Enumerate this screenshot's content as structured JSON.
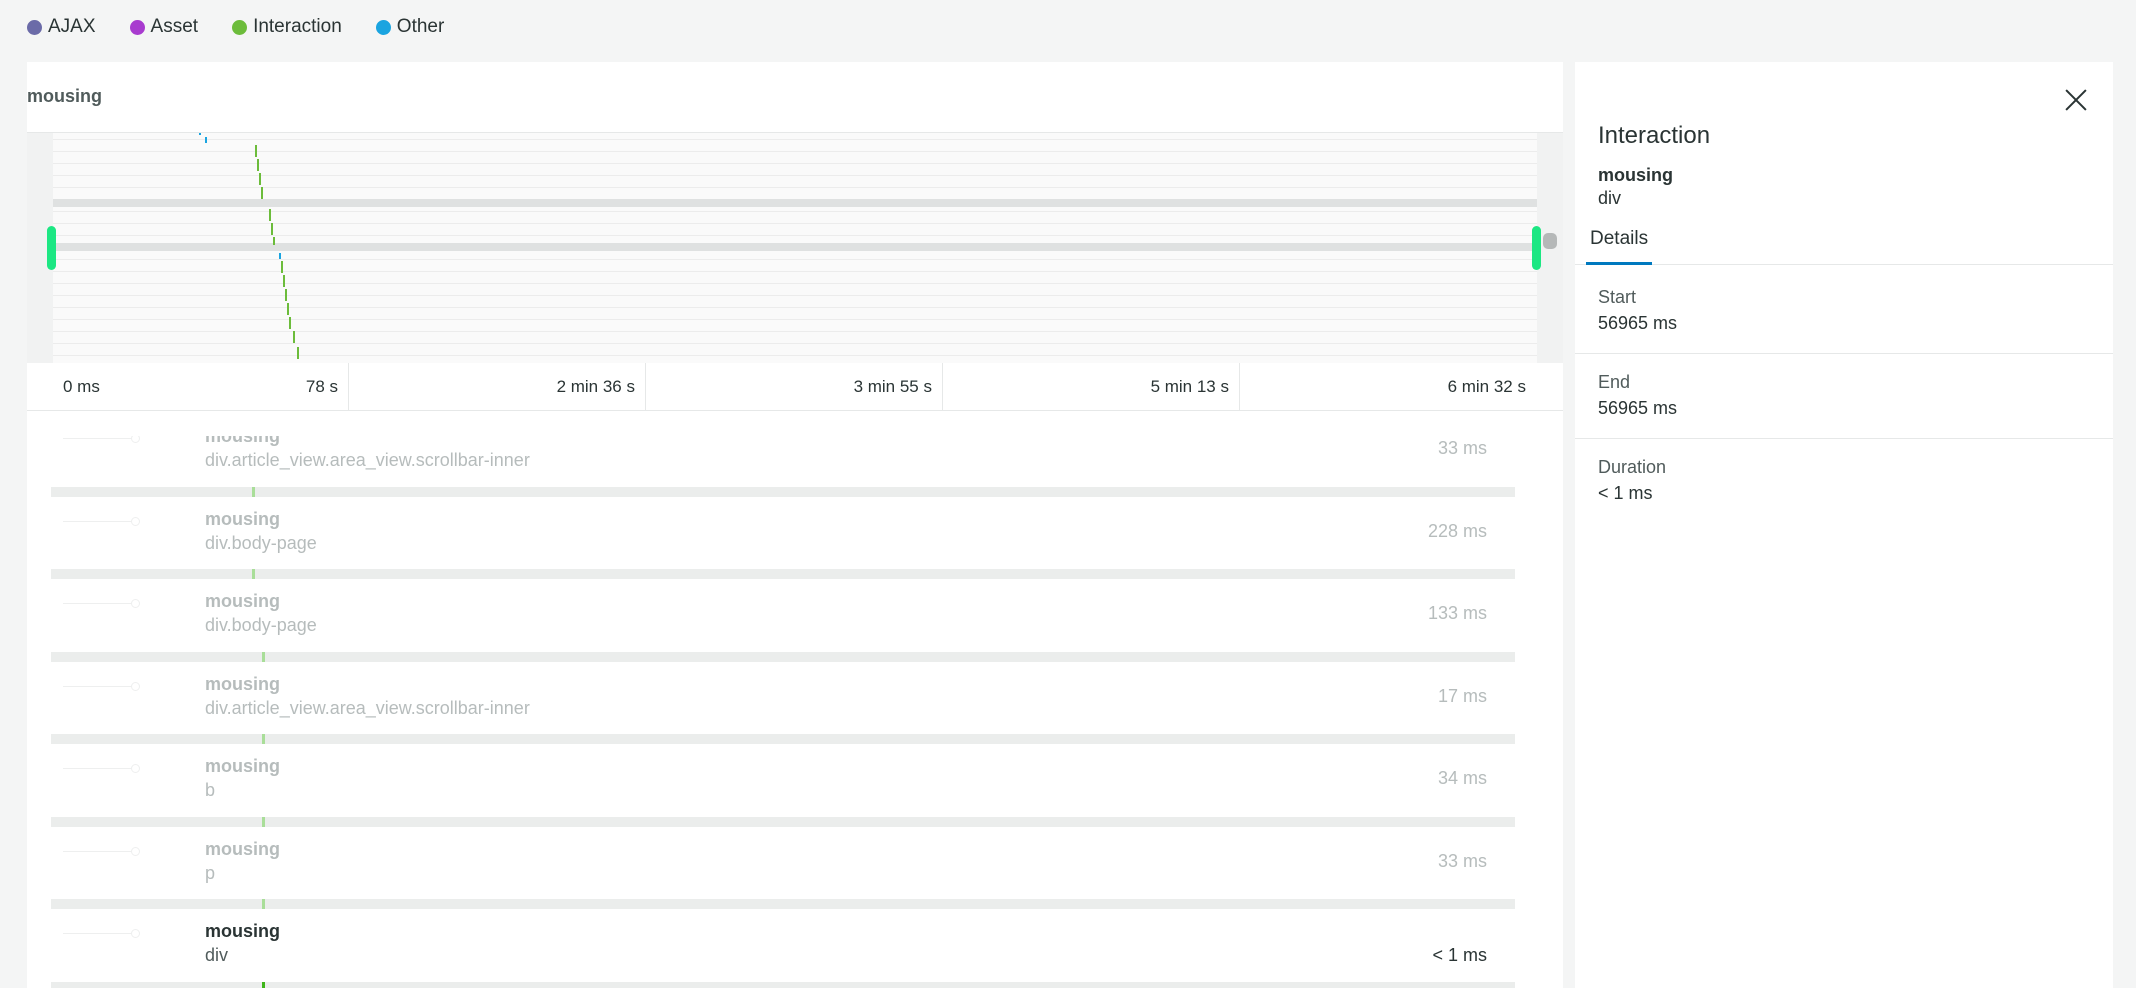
{
  "legend": [
    {
      "label": "AJAX",
      "color": "#6b6ba8"
    },
    {
      "label": "Asset",
      "color": "#a83bcf"
    },
    {
      "label": "Interaction",
      "color": "#6cbc3b"
    },
    {
      "label": "Other",
      "color": "#1aa4e0"
    }
  ],
  "panel": {
    "title": "mousing"
  },
  "axis": {
    "ticks": [
      "0 ms",
      "78 s",
      "2 min 36 s",
      "3 min 55 s",
      "5 min 13 s",
      "6 min 32 s"
    ]
  },
  "rows": [
    {
      "name": "mousing",
      "sub": "div.article_view.area_view.scrollbar-inner",
      "duration": "33 ms"
    },
    {
      "name": "mousing",
      "sub": "div.body-page",
      "duration": "228 ms"
    },
    {
      "name": "mousing",
      "sub": "div.body-page",
      "duration": "133 ms"
    },
    {
      "name": "mousing",
      "sub": "div.article_view.area_view.scrollbar-inner",
      "duration": "17 ms"
    },
    {
      "name": "mousing",
      "sub": "b",
      "duration": "34 ms"
    },
    {
      "name": "mousing",
      "sub": "p",
      "duration": "33 ms"
    },
    {
      "name": "mousing",
      "sub": "div",
      "duration": "< 1 ms"
    }
  ],
  "detail": {
    "heading": "Interaction",
    "name": "mousing",
    "sub": "div",
    "tab": "Details",
    "start_label": "Start",
    "start_value": "56965 ms",
    "end_label": "End",
    "end_value": "56965 ms",
    "duration_label": "Duration",
    "duration_value": "< 1 ms"
  }
}
